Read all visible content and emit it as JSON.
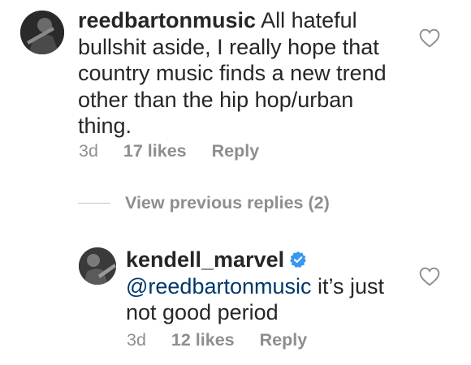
{
  "comment1": {
    "username": "reedbartonmusic",
    "text": " All hateful bullshit aside, I really hope that country music finds a new trend other than the hip hop/urban thing.",
    "time": "3d",
    "likes": "17 likes",
    "reply": "Reply"
  },
  "view_previous": "View previous replies (2)",
  "comment2": {
    "username": "kendell_marvel",
    "mention": "@reedbartonmusic",
    "text": " it’s just not good period",
    "time": "3d",
    "likes": "12 likes",
    "reply": "Reply"
  },
  "icons": {
    "like": "heart-outline-icon",
    "verified": "verified-badge-icon"
  },
  "colors": {
    "text": "#262626",
    "secondary": "#8e8e8e",
    "mention": "#00376b",
    "verified": "#3897f0"
  }
}
